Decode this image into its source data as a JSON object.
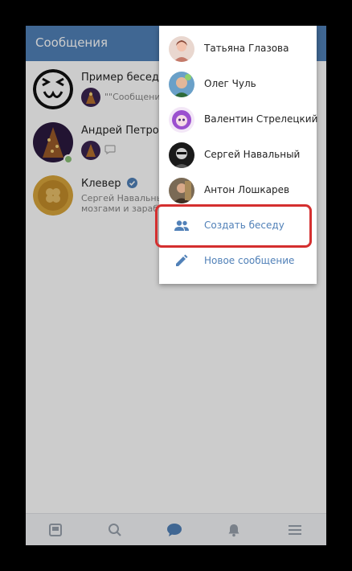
{
  "header": {
    "title": "Сообщения"
  },
  "conversations": [
    {
      "name": "Пример беседы",
      "preview": "\"\"Сообщени"
    },
    {
      "name": "Андрей Петров",
      "preview": ""
    },
    {
      "name": "Клевер",
      "preview_line1": "Сергей Навальный",
      "preview_line2": "мозгами и зараб"
    }
  ],
  "menu": {
    "contacts": [
      {
        "name": "Татьяна Глазова"
      },
      {
        "name": "Олег Чуль"
      },
      {
        "name": "Валентин Стрелецкий"
      },
      {
        "name": "Сергей Навальный"
      },
      {
        "name": "Антон Лошкарев"
      }
    ],
    "create_chat_label": "Создать беседу",
    "new_message_label": "Новое сообщение"
  },
  "tabbar": {
    "icons": [
      "news-icon",
      "search-icon",
      "messages-icon",
      "notifications-icon",
      "menu-icon"
    ]
  },
  "colors": {
    "brand": "#5181b8",
    "highlight": "#d42f2f",
    "online": "#8ac176"
  }
}
